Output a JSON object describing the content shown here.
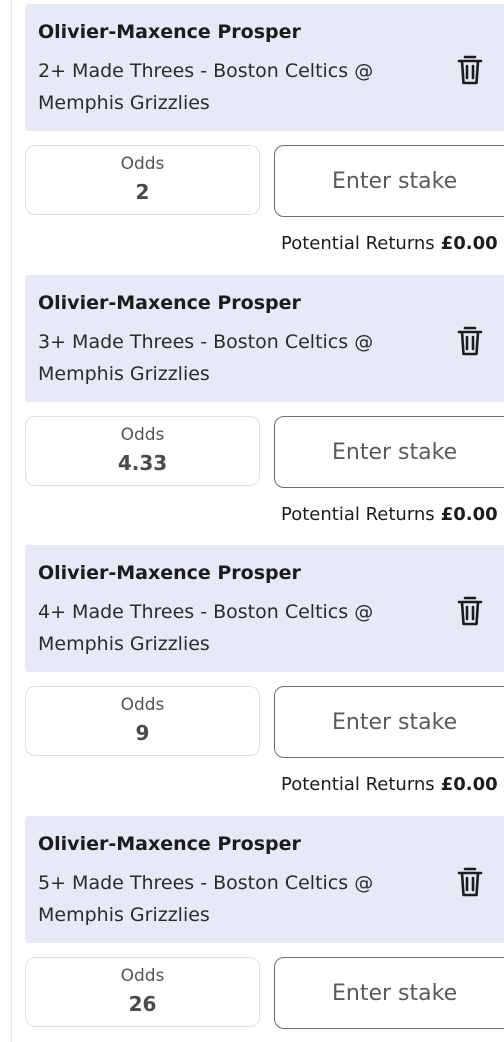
{
  "bets": [
    {
      "player": "Olivier-Maxence Prosper",
      "market": "2+ Made Threes - Boston Celtics @ Memphis Grizzlies",
      "odds_label": "Odds",
      "odds": "2",
      "stake_placeholder": "Enter stake",
      "returns_label": "Potential Returns",
      "returns_amount": "£0.00"
    },
    {
      "player": "Olivier-Maxence Prosper",
      "market": "3+ Made Threes - Boston Celtics @ Memphis Grizzlies",
      "odds_label": "Odds",
      "odds": "4.33",
      "stake_placeholder": "Enter stake",
      "returns_label": "Potential Returns",
      "returns_amount": "£0.00"
    },
    {
      "player": "Olivier-Maxence Prosper",
      "market": "4+ Made Threes - Boston Celtics @ Memphis Grizzlies",
      "odds_label": "Odds",
      "odds": "9",
      "stake_placeholder": "Enter stake",
      "returns_label": "Potential Returns",
      "returns_amount": "£0.00"
    },
    {
      "player": "Olivier-Maxence Prosper",
      "market": "5+ Made Threes - Boston Celtics @ Memphis Grizzlies",
      "odds_label": "Odds",
      "odds": "26",
      "stake_placeholder": "Enter stake"
    }
  ],
  "icons": {
    "remove": "trash-icon"
  },
  "colors": {
    "header_bg": "#e6eaf7",
    "text": "#1c1c1c"
  }
}
